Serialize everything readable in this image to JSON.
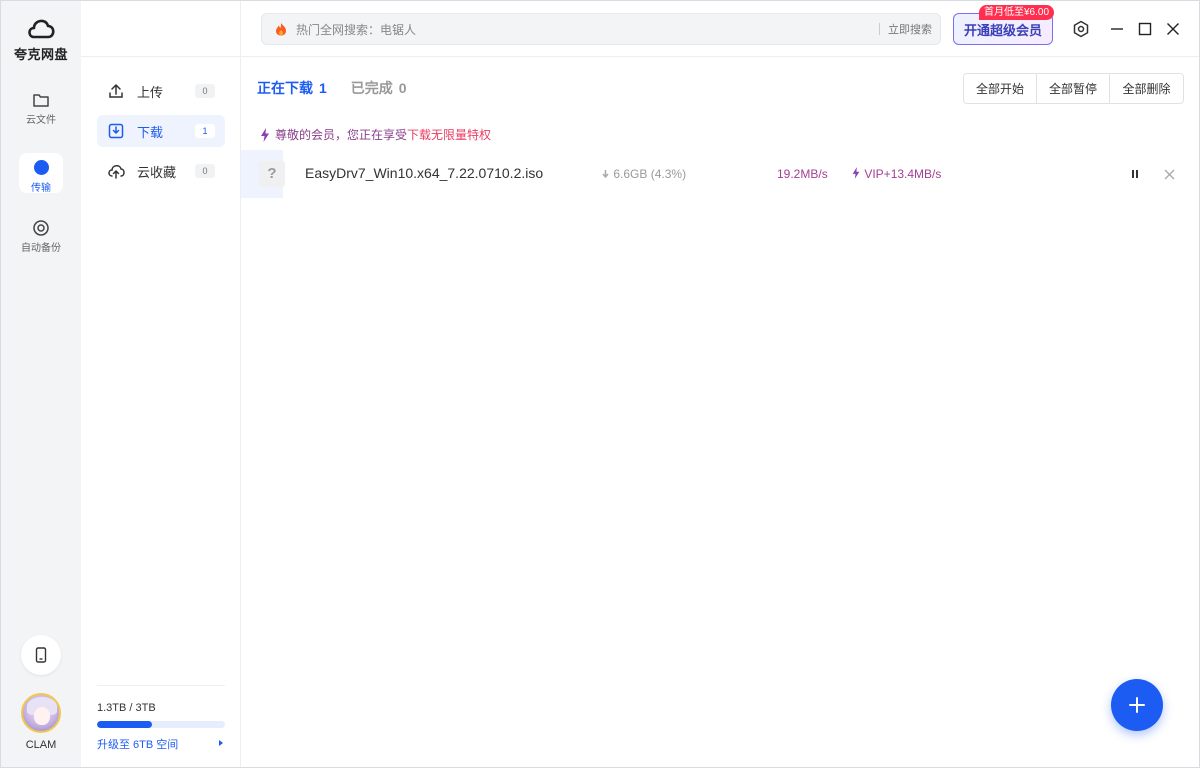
{
  "app": {
    "name": "夸克网盘"
  },
  "rail": {
    "items": [
      {
        "label": "云文件",
        "icon": "folder-icon"
      },
      {
        "label": "传输",
        "icon": "transfer-dot-icon"
      },
      {
        "label": "自动备份",
        "icon": "backup-icon"
      }
    ],
    "phone_icon": "phone-icon",
    "username": "CLAM"
  },
  "subnav": {
    "items": [
      {
        "label": "上传",
        "count": "0",
        "icon": "upload-icon"
      },
      {
        "label": "下载",
        "count": "1",
        "icon": "download-icon"
      },
      {
        "label": "云收藏",
        "count": "0",
        "icon": "cloud-upload-icon"
      }
    ],
    "storage": {
      "used": "1.3TB",
      "total": "3TB",
      "fraction": 0.43,
      "upgrade_label": "升级至 6TB 空间"
    }
  },
  "titlebar": {
    "search_placeholder": "热门全网搜索：电锯人",
    "search_button": "立即搜索",
    "vip_button": "开通超级会员",
    "vip_badge": "首月低至¥6.00"
  },
  "main": {
    "tabs": [
      {
        "label": "正在下载",
        "count": "1"
      },
      {
        "label": "已完成",
        "count": "0"
      }
    ],
    "actions": [
      "全部开始",
      "全部暂停",
      "全部删除"
    ],
    "notice_prefix": "尊敬的会员，您正在享受",
    "notice_highlight": "下载无限量特权",
    "downloads": [
      {
        "filename": "EasyDrv7_Win10.x64_7.22.0710.2.iso",
        "size": "6.6GB",
        "percent": "(4.3%)",
        "speed": "19.2MB/s",
        "vip_speed": "VIP+13.4MB/s"
      }
    ]
  },
  "colors": {
    "accent": "#1d5cf2",
    "vip": "#a43e93",
    "badge": "#ff2f4f"
  }
}
